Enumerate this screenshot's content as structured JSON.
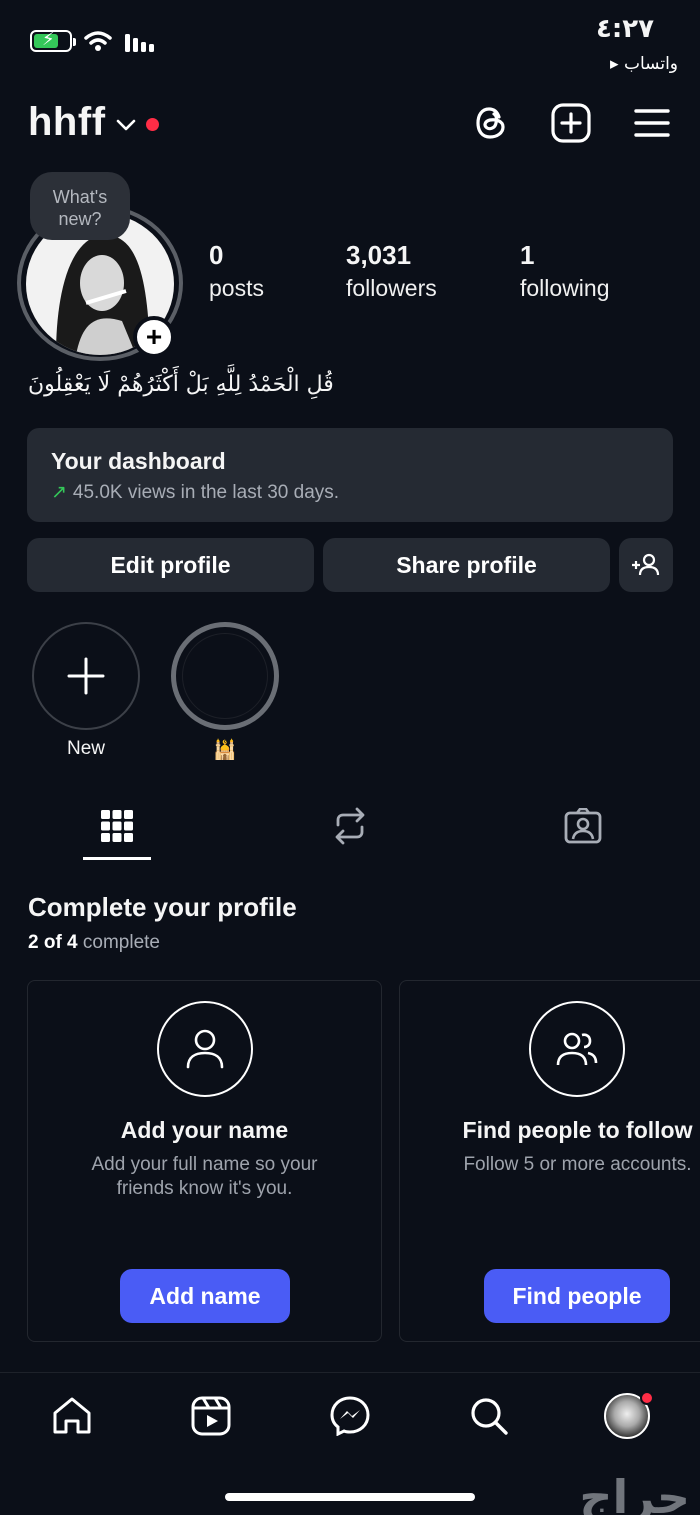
{
  "status_bar": {
    "time": "٤:٢٧",
    "back_app": "▸ واتساب"
  },
  "header": {
    "username": "hhff",
    "icons": [
      "threads-icon",
      "create-post-icon",
      "menu-icon"
    ]
  },
  "profile": {
    "bubble_text": "What's new?",
    "stats": [
      {
        "value": "0",
        "label": "posts"
      },
      {
        "value": "3,031",
        "label": "followers"
      },
      {
        "value": "1",
        "label": "following"
      }
    ],
    "bio": "قُلِ الْحَمْدُ لِلَّهِ بَلْ أَكْثَرُهُمْ لَا يَعْقِلُونَ"
  },
  "dashboard": {
    "title": "Your dashboard",
    "subtitle": "45.0K views in the last 30 days."
  },
  "actions": {
    "edit_label": "Edit profile",
    "share_label": "Share profile"
  },
  "highlights": [
    {
      "label": "New"
    },
    {
      "label": "🕌"
    }
  ],
  "complete_profile": {
    "title": "Complete your profile",
    "progress_count": "2 of 4",
    "progress_word": "complete",
    "cards": [
      {
        "title": "Add your name",
        "description": "Add your full name so your friends know it's you.",
        "button": "Add name"
      },
      {
        "title": "Find people to follow",
        "description": "Follow 5 or more accounts.",
        "button": "Find people"
      }
    ]
  },
  "watermark": "حراج",
  "colors": {
    "background": "#0b0f18",
    "card": "#252a33",
    "accent": "#4a5cf5",
    "notification": "#ff2d46",
    "trend": "#34c759"
  }
}
